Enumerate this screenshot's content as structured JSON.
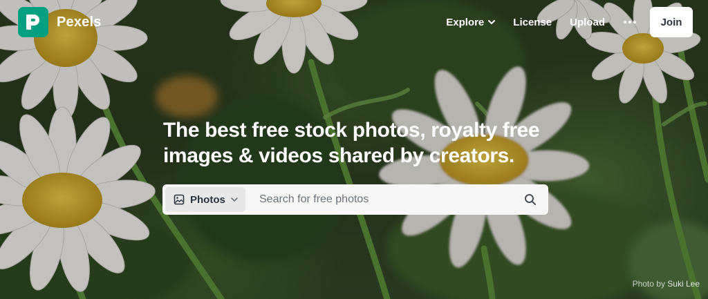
{
  "brand": {
    "name": "Pexels",
    "accent": "#05a081"
  },
  "nav": {
    "explore": "Explore",
    "license": "License",
    "upload": "Upload",
    "more_icon": "more-horizontal-icon",
    "join": "Join"
  },
  "hero": {
    "headline_line1": "The best free stock photos, royalty free",
    "headline_line2": "images & videos shared by creators."
  },
  "search": {
    "type_selected": "Photos",
    "placeholder": "Search for free photos",
    "value": ""
  },
  "credit": {
    "prefix": "Photo by",
    "author": "Suki Lee"
  },
  "colors": {
    "button_bg": "#ffffff",
    "search_bg": "#f7f7f7",
    "type_chip_bg": "#e8e8e8"
  }
}
